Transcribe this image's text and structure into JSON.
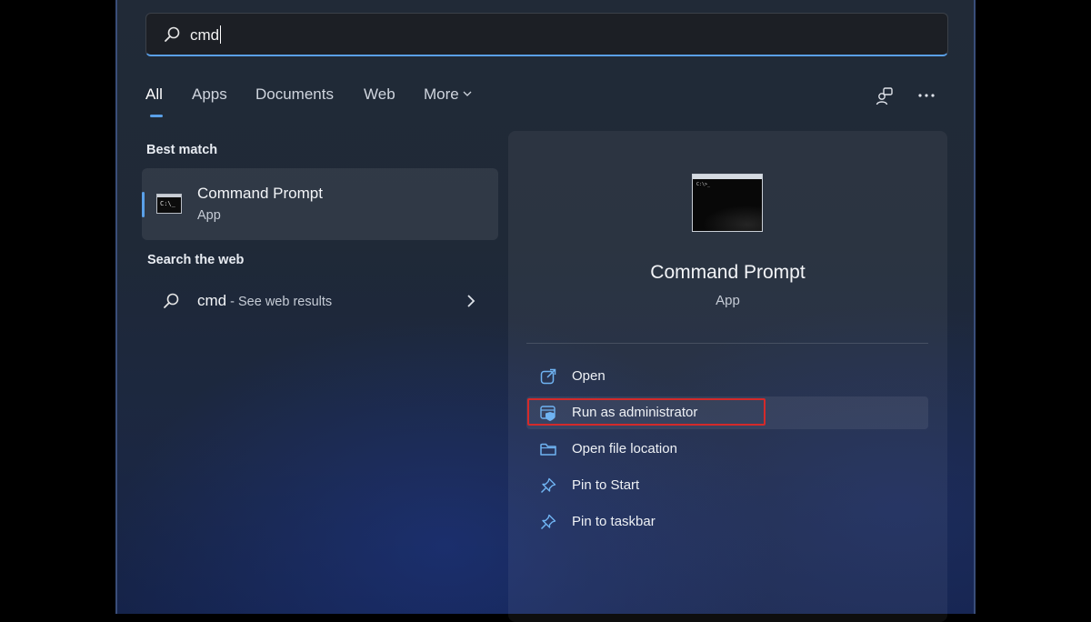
{
  "search": {
    "query": "cmd"
  },
  "tabs": [
    {
      "label": "All",
      "active": true
    },
    {
      "label": "Apps"
    },
    {
      "label": "Documents"
    },
    {
      "label": "Web"
    },
    {
      "label": "More"
    }
  ],
  "toolbar": {
    "icons": [
      "feedback-icon",
      "more-options-icon"
    ]
  },
  "best_match": {
    "section_title": "Best match",
    "title": "Command Prompt",
    "subtitle": "App"
  },
  "web_search": {
    "section_title": "Search the web",
    "query": "cmd",
    "hint": " - See web results"
  },
  "detail": {
    "title": "Command Prompt",
    "subtitle": "App",
    "actions": [
      {
        "label": "Open",
        "icon": "open-external-icon"
      },
      {
        "label": "Run as administrator",
        "icon": "admin-shield-icon",
        "highlighted": true
      },
      {
        "label": "Open file location",
        "icon": "folder-icon"
      },
      {
        "label": "Pin to Start",
        "icon": "pin-icon"
      },
      {
        "label": "Pin to taskbar",
        "icon": "pin-icon"
      }
    ]
  },
  "colors": {
    "accent": "#5aa0e8",
    "highlight_border": "#d42a2a",
    "panel": "#1f2937"
  }
}
